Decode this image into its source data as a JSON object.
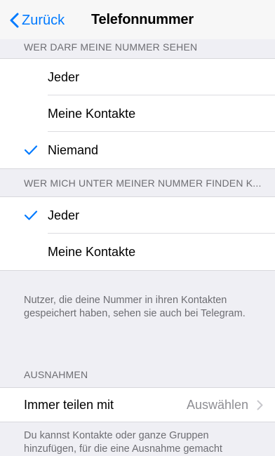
{
  "navbar": {
    "back_label": "Zurück",
    "title": "Telefonnummer"
  },
  "section1": {
    "header": "WER DARF MEINE NUMMER SEHEN",
    "options": [
      {
        "label": "Jeder",
        "checked": false
      },
      {
        "label": "Meine Kontakte",
        "checked": false
      },
      {
        "label": "Niemand",
        "checked": true
      }
    ]
  },
  "section2": {
    "header": "WER MICH UNTER MEINER NUMMER FINDEN K...",
    "options": [
      {
        "label": "Jeder",
        "checked": true
      },
      {
        "label": "Meine Kontakte",
        "checked": false
      }
    ],
    "footer": "Nutzer, die deine Nummer in ihren Kontakten gespeichert haben, sehen sie auch bei Telegram."
  },
  "section3": {
    "header": "AUSNAHMEN",
    "row_label": "Immer teilen mit",
    "row_value": "Auswählen",
    "footer": "Du kannst Kontakte oder ganze Gruppen hinzufügen, für die eine Ausnahme gemacht"
  },
  "colors": {
    "accent": "#007aff",
    "background": "#efeff4",
    "secondary_text": "#6d6d72"
  },
  "icons": {
    "back": "chevron-left-icon",
    "check": "checkmark-icon",
    "disclosure": "chevron-right-icon"
  }
}
